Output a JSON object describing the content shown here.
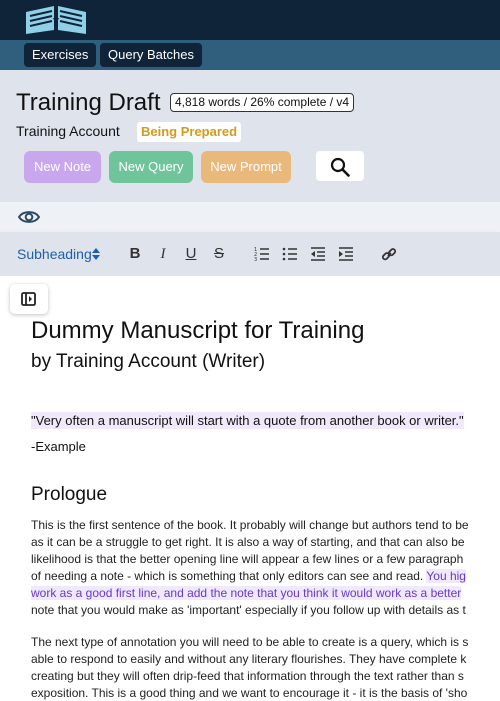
{
  "nav": {
    "exercises": "Exercises",
    "query_batches": "Query Batches"
  },
  "header": {
    "title": "Training Draft",
    "stats": "4,818 words / 26% complete / v4",
    "account": "Training Account",
    "status": "Being Prepared"
  },
  "actions": {
    "new_note": "New Note",
    "new_query": "New Query",
    "new_prompt": "New Prompt"
  },
  "colors": {
    "note": "#c9a7ee",
    "query": "#6fc49b",
    "prompt": "#e9b97c",
    "status": "#d49a1c",
    "highlight": "#6a39c7"
  },
  "toolbar": {
    "style": "Subheading"
  },
  "manuscript": {
    "title": "Dummy Manuscript for Training",
    "byline": "by Training Account (Writer)",
    "quote": "\"Very often a manuscript will start with a quote from another book or writer.\"",
    "attribution": "-Example",
    "heading": "Prologue",
    "p1_l1": "This is the first sentence of the book. It probably will change but authors tend to be",
    "p1_l2": "as it can be a struggle to get right. It is also a way of starting, and that can also be",
    "p1_l3": "likelihood is that the better opening line will appear a few lines or a few paragraph",
    "p1_l4a": "of needing a note - which is something that only editors can see and read. ",
    "p1_l4b": "You hig",
    "p1_l5a": "work as a good first line, and add the note that you think it would work as a better",
    "p1_l6": "note that you would make as 'important' especially if you follow up with details as t",
    "p2_l1": "The next type of annotation you will need to be able to create is a query, which is s",
    "p2_l2": "able to respond to easily and without any literary flourishes. They have complete k",
    "p2_l3": "creating but they will often drip-feed that information through the text rather than s",
    "p2_l4": "exposition. This is a good thing and we want to encourage it - it is the basis of 'sho"
  }
}
